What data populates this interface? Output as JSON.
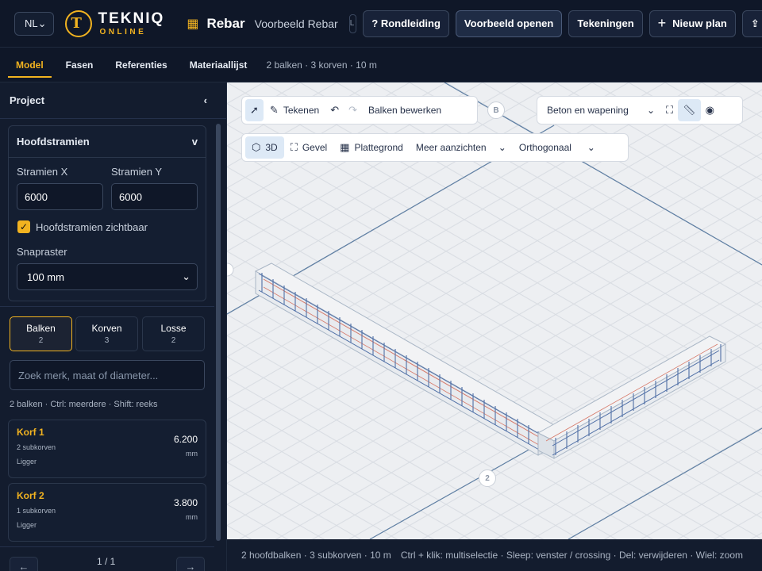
{
  "topbar": {
    "language": "NL",
    "logo": {
      "wordmark": "TEKNIQ",
      "tagline": "ONLINE"
    },
    "app_name": "Rebar",
    "document_name": "Voorbeeld Rebar",
    "mini_label": "L",
    "buttons": {
      "tour": "? Rondleiding",
      "open_example": "Voorbeeld openen",
      "drawings": "Tekeningen",
      "new_plan": "Nieuw plan"
    }
  },
  "tabs": {
    "items": [
      "Model",
      "Fasen",
      "Referenties",
      "Materiaallijst"
    ],
    "active": "Model",
    "summary": "2 balken · 3 korven · 10 m"
  },
  "sidebar": {
    "title": "Project",
    "collapse_icon": "‹",
    "grid_card": {
      "title": "Hoofdstramien",
      "chevron": "v",
      "label_x": "Stramien X",
      "value_x": "6000",
      "label_y": "Stramien Y",
      "value_y": "6000",
      "visible_label": "Hoofdstramien zichtbaar",
      "visible_checked": true,
      "snap_label": "Snapraster",
      "snap_value": "100 mm"
    },
    "segments": [
      {
        "label": "Balken",
        "count": "2"
      },
      {
        "label": "Korven",
        "count": "3"
      },
      {
        "label": "Losse",
        "count": "2"
      }
    ],
    "active_segment": "Balken",
    "search_placeholder": "Zoek merk, maat of diameter...",
    "hint": "2 balken · Ctrl: meerdere · Shift: reeks",
    "items": [
      {
        "name": "Korf 1",
        "sub": "2 subkorven",
        "type": "Ligger",
        "value": "6.200",
        "unit": "mm"
      },
      {
        "name": "Korf 2",
        "sub": "1 subkorven",
        "type": "Ligger",
        "value": "3.800",
        "unit": "mm"
      }
    ],
    "pager": {
      "prev": "←",
      "label": "1 / 1",
      "next": "→"
    }
  },
  "viewport": {
    "toolbar1": {
      "draw": "Tekenen",
      "edit_beams": "Balken bewerken"
    },
    "toolbar_right": {
      "view_select": "Beton en wapening"
    },
    "toolbar2": {
      "view_3d": "3D",
      "facade": "Gevel",
      "floorplan": "Plattegrond",
      "more_views": "Meer aanzichten",
      "projection": "Orthogonaal"
    },
    "grid_markers": {
      "b": "B",
      "two": "2"
    },
    "colors": {
      "grid_line": "#5f7fa3",
      "rebar": "#4f6fa6",
      "rebar_long": "#d67a6a"
    }
  },
  "statusbar": {
    "left": "2 hoofdbalken · 3 subkorven · 10 m",
    "right": "Ctrl + klik: multiselectie · Sleep: venster / crossing · Del: verwijderen · Wiel: zoom"
  }
}
